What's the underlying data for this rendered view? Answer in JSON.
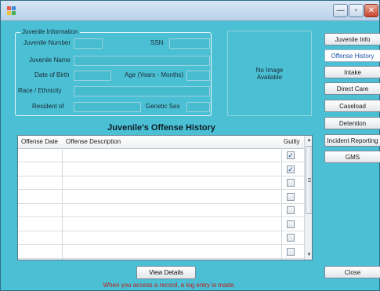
{
  "window": {
    "title": "",
    "icon": "app-icon"
  },
  "titlebar_buttons": {
    "minimize": "—",
    "maximize": "▫",
    "close": "✕"
  },
  "juvenile_info": {
    "legend": "Juvenile Information",
    "fields": {
      "juvenile_number": {
        "label": "Juvenile Number",
        "value": ""
      },
      "ssn": {
        "label": "SSN",
        "value": ""
      },
      "juvenile_name": {
        "label": "Juvenile Name",
        "value": ""
      },
      "date_of_birth": {
        "label": "Date of Birth",
        "value": ""
      },
      "age": {
        "label": "Age (Years - Months)",
        "value": ""
      },
      "race_ethnicity": {
        "label": "Race / Ethnicity",
        "value": ""
      },
      "resident_of": {
        "label": "Resident of",
        "value": ""
      },
      "genetic_sex": {
        "label": "Genetic Sex",
        "value": ""
      }
    }
  },
  "photo": {
    "placeholder": "No Image Available"
  },
  "nav": {
    "items": [
      {
        "label": "Juvenile Info",
        "active": false
      },
      {
        "label": "Offense History",
        "active": true
      },
      {
        "label": "Intake",
        "active": false
      },
      {
        "label": "Direct Care",
        "active": false
      },
      {
        "label": "Caseload",
        "active": false
      },
      {
        "label": "Detention",
        "active": false
      },
      {
        "label": "Incident Reporting",
        "active": false
      },
      {
        "label": "GMS",
        "active": false
      }
    ],
    "close_label": "Close"
  },
  "offense_history": {
    "title": "Juvenile's Offense History",
    "columns": [
      "Offense Date",
      "Offense Description",
      "Guilty"
    ],
    "rows": [
      {
        "offense_date": "",
        "description": "",
        "guilty": true
      },
      {
        "offense_date": "",
        "description": "",
        "guilty": true
      },
      {
        "offense_date": "",
        "description": "",
        "guilty": false
      },
      {
        "offense_date": "",
        "description": "",
        "guilty": false
      },
      {
        "offense_date": "",
        "description": "",
        "guilty": false
      },
      {
        "offense_date": "",
        "description": "",
        "guilty": false
      },
      {
        "offense_date": "",
        "description": "",
        "guilty": false
      },
      {
        "offense_date": "",
        "description": "",
        "guilty": false
      }
    ],
    "scrollbar": {
      "up": "▲",
      "down": "▼"
    }
  },
  "actions": {
    "view_details_label": "View Details"
  },
  "log_notice": "When you access a record, a log entry is made.",
  "colors": {
    "background": "#4bc0d4",
    "notice": "#c21a1a",
    "active_nav_text": "#1f4fa8"
  }
}
